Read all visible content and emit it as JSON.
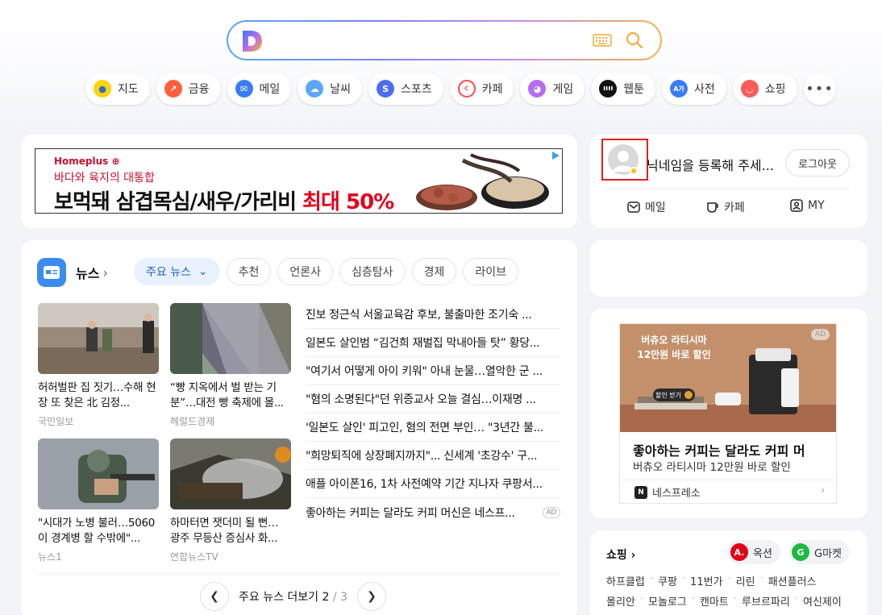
{
  "search": {
    "placeholder": "",
    "value": ""
  },
  "shortcuts": [
    {
      "label": "지도",
      "icon": "map-pin-icon",
      "color": "#ffd400"
    },
    {
      "label": "금융",
      "icon": "finance-chart-icon",
      "color": "#ff5f3a"
    },
    {
      "label": "메일",
      "icon": "mail-icon",
      "color": "#3b7cf6"
    },
    {
      "label": "날씨",
      "icon": "weather-cloud-icon",
      "color": "#5aa7f6"
    },
    {
      "label": "스포츠",
      "icon": "sports-icon",
      "color": "#4e6cf2"
    },
    {
      "label": "카페",
      "icon": "cafe-icon",
      "color": "#ff4a4a"
    },
    {
      "label": "게임",
      "icon": "game-controller-icon",
      "color": "#b56cf2"
    },
    {
      "label": "웹툰",
      "icon": "webtoon-icon",
      "color": "#111111"
    },
    {
      "label": "사전",
      "icon": "dictionary-icon",
      "color": "#3b7cf6"
    },
    {
      "label": "쇼핑",
      "icon": "shopping-bag-icon",
      "color": "#ff5a5a"
    }
  ],
  "ad_banner": {
    "logo": "Homeplus",
    "subtitle": "바다와 육지의 대통합",
    "headline": "보먹돼 삼겹목심/새우/가리비 ",
    "highlight": "최대 50%"
  },
  "login": {
    "nickname": "닉네임을 등록해 주세...",
    "logout_label": "로그아웃",
    "links": [
      {
        "label": "메일",
        "icon": "mail-outline-icon"
      },
      {
        "label": "카페",
        "icon": "cafe-cup-icon"
      },
      {
        "label": "MY",
        "icon": "my-profile-icon"
      }
    ]
  },
  "news": {
    "title": "뉴스",
    "tabs": [
      {
        "label": "주요 뉴스",
        "active": true
      },
      {
        "label": "추천",
        "active": false
      },
      {
        "label": "언론사",
        "active": false
      },
      {
        "label": "심층탐사",
        "active": false
      },
      {
        "label": "경제",
        "active": false
      },
      {
        "label": "라이브",
        "active": false
      }
    ],
    "thumbs": [
      {
        "caption": "허허벌판 집 짓기…수해 현장 또 찾은 北 김정...",
        "source": "국민일보"
      },
      {
        "caption": "“빵 지옥에서 벌 받는 기분”…대전 빵 축제에 몰...",
        "source": "헤럴드경제"
      },
      {
        "caption": "\"시대가 노병 불러…5060이 경계병 할 수밖에\"...",
        "source": "뉴스1"
      },
      {
        "caption": "하마터면 잿더미 될 뻔… 광주 무등산 증심사 화...",
        "source": "연합뉴스TV"
      }
    ],
    "headlines": [
      "진보 정근식 서울교육감 후보, 불출마한 조기숙 ...",
      "일본도 살인범 “김건희 재벌집 막내아들 탓” 황당...",
      "\"여기서 어떻게 아이 키워\" 아내 눈물…열악한 군 ...",
      "\"혐의 소명된다\"던 위증교사 오늘 결심…이재명 ...",
      "'일본도 살인' 피고인, 혐의 전면 부인… \"3년간 불...",
      "\"희망퇴직에 상장폐지까지\"... 신세계 '초강수' 구...",
      "애플 아이폰16, 1차 사전예약 기간 지나자 쿠팡서...",
      "좋아하는 커피는 달라도 커피 머신은 네스프..."
    ],
    "ad_label": "AD",
    "more_label": "주요 뉴스 더보기",
    "page_current": "2",
    "page_total": "3"
  },
  "promo": {
    "ad_label": "AD",
    "image_line1": "버츄오 라티시마",
    "image_line2": "12만원 바로 할인",
    "image_button": "할인 받기",
    "title": "좋아하는 커피는 달라도 커피 머",
    "subtitle": "버츄오 라티시마 12만원 바로 할인",
    "brand": "네스프레소"
  },
  "shopping": {
    "title": "쇼핑",
    "chips": [
      {
        "label": "옥션",
        "icon": "auction-icon",
        "color": "#e2001a"
      },
      {
        "label": "G마켓",
        "icon": "gmarket-icon",
        "color": "#1fb843"
      }
    ],
    "links_row1": [
      "하프클럽",
      "쿠팡",
      "11번가",
      "리린",
      "패션플러스"
    ],
    "links_row2": [
      "몰리안",
      "모놀로그",
      "캔마트",
      "루브르파리",
      "여신제이"
    ]
  }
}
